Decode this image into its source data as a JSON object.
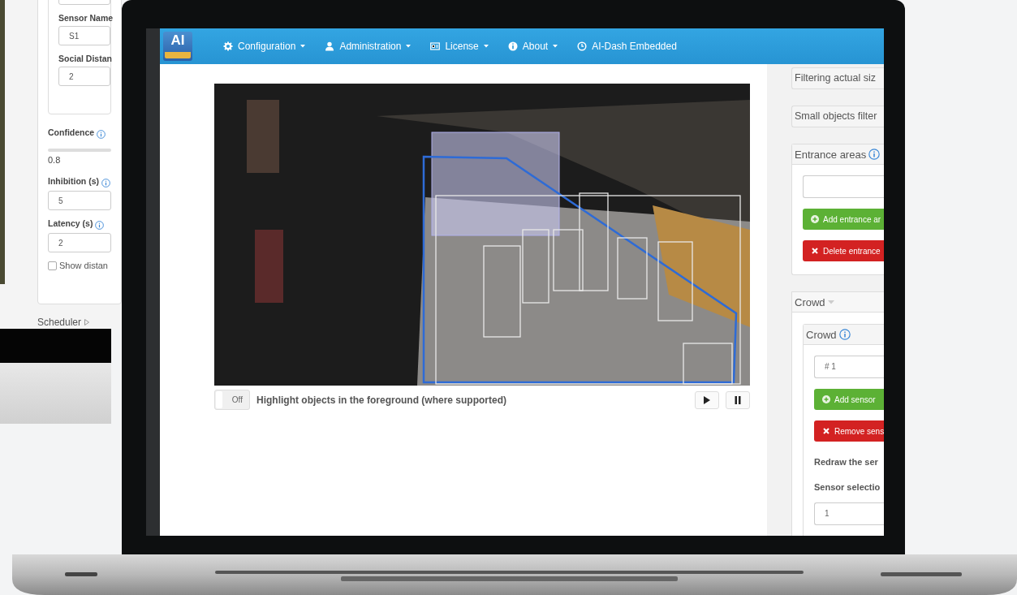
{
  "background_form": {
    "card_items": [
      {
        "kind": "field"
      },
      {
        "kind": "label",
        "text": "Sensor Name"
      },
      {
        "kind": "field",
        "value": "S1"
      },
      {
        "kind": "label",
        "text": "Social Distan"
      },
      {
        "kind": "field",
        "value": "2"
      }
    ],
    "items": [
      {
        "kind": "info_label",
        "text": "Confidence"
      },
      {
        "kind": "slider"
      },
      {
        "kind": "text",
        "text": "0.8"
      },
      {
        "kind": "info_label",
        "text": "Inhibition (s)"
      },
      {
        "kind": "field",
        "value": "5"
      },
      {
        "kind": "info_label",
        "text": "Latency (s)"
      },
      {
        "kind": "field",
        "value": "2"
      },
      {
        "kind": "checkbox",
        "text": "Show distan",
        "checked": false
      }
    ],
    "section": "Scheduler"
  },
  "navbar": {
    "logo": "AI",
    "menus": [
      {
        "label": "Configuration",
        "dropdown": true
      },
      {
        "label": "Administration",
        "dropdown": true
      },
      {
        "label": "License",
        "dropdown": true
      },
      {
        "label": "About",
        "dropdown": true
      },
      {
        "label": "AI-Dash Embedded",
        "dropdown": false
      }
    ]
  },
  "video": {
    "toggle": {
      "label": "Off",
      "on": false
    },
    "caption": "Highlight objects in the foreground (where supported)"
  },
  "side_panels": [
    {
      "kind": "collapsed",
      "title": "Filtering actual siz"
    },
    {
      "kind": "collapsed",
      "title": "Small objects filter"
    },
    {
      "kind": "panel",
      "title": "Entrance areas",
      "info": true,
      "body": [
        {
          "kind": "field"
        },
        {
          "kind": "add_button",
          "label": "Add entrance ar"
        },
        {
          "kind": "delete_button",
          "label": "Delete entrance"
        }
      ]
    },
    {
      "kind": "group",
      "title": "Crowd",
      "children": [
        {
          "kind": "panel",
          "title": "Crowd",
          "info": true,
          "body": [
            {
              "kind": "field",
              "value": "# 1"
            },
            {
              "kind": "add_button",
              "label": "Add sensor"
            },
            {
              "kind": "delete_button",
              "label": "Remove sens"
            },
            {
              "kind": "label",
              "text": "Redraw the ser"
            },
            {
              "kind": "label",
              "text": "Sensor selectio"
            },
            {
              "kind": "field",
              "value": "1"
            }
          ]
        }
      ]
    }
  ]
}
